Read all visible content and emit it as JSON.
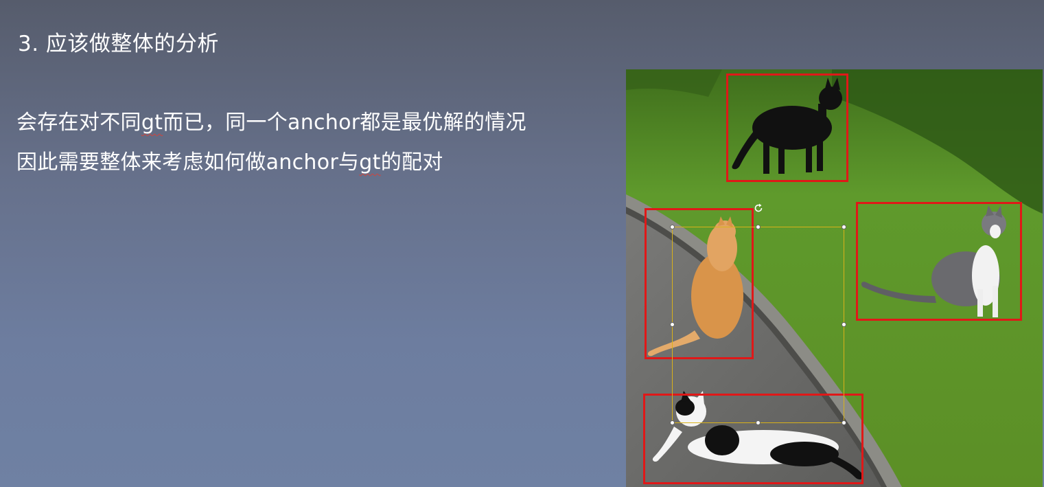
{
  "slide": {
    "title": "3. 应该做整体的分析",
    "line1_a": "会存在对不同",
    "line1_gt": "gt",
    "line1_b": "而已，同一个anchor都是最优解的情况",
    "line2_a": "因此需要整体来考虑如何做anchor与",
    "line2_gt": "gt",
    "line2_b": "的配对"
  },
  "image": {
    "subject": "cats-on-path-with-detection-boxes",
    "box_color": "#e01818",
    "selection_color": "#d9b21a",
    "icons": [
      "rotate-handle-icon"
    ]
  }
}
